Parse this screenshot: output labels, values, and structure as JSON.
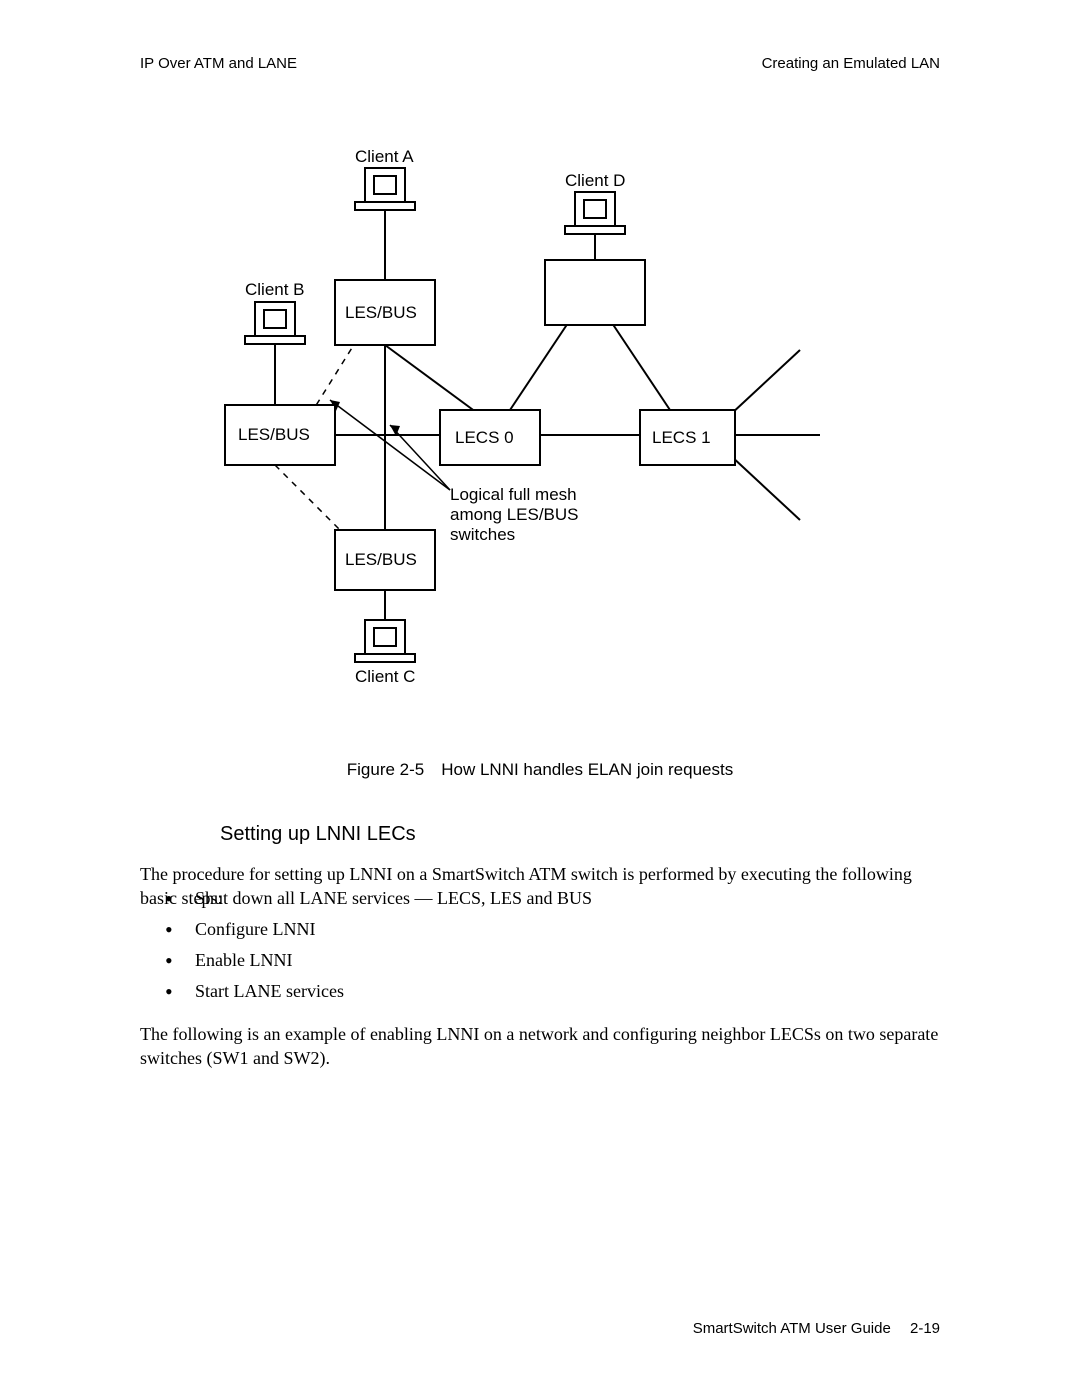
{
  "header": {
    "left": "IP Over ATM and LANE",
    "right": "Creating an Emulated LAN"
  },
  "diagram": {
    "clientA": "Client A",
    "clientB": "Client B",
    "clientC": "Client C",
    "clientD": "Client D",
    "lesbus": "LES/BUS",
    "lecs0": "LECS 0",
    "lecs1": "LECS 1",
    "annotation_l1": "Logical full mesh",
    "annotation_l2": "among LES/BUS",
    "annotation_l3": "switches"
  },
  "figure_caption": "Figure 2-5 How LNNI handles ELAN join requests",
  "section_heading": "Setting up LNNI LECs",
  "paragraph1": "The procedure for setting up LNNI on a SmartSwitch ATM switch is performed by executing the following basic steps:",
  "steps": {
    "s1": "Shut down all LANE services — LECS, LES and BUS",
    "s2": "Configure LNNI",
    "s3": "Enable LNNI",
    "s4": "Start LANE services"
  },
  "paragraph2": "The following is an example of enabling LNNI on a network and configuring neighbor LECSs on two separate switches (SW1 and SW2).",
  "footer": "SmartSwitch ATM User Guide  2-19"
}
